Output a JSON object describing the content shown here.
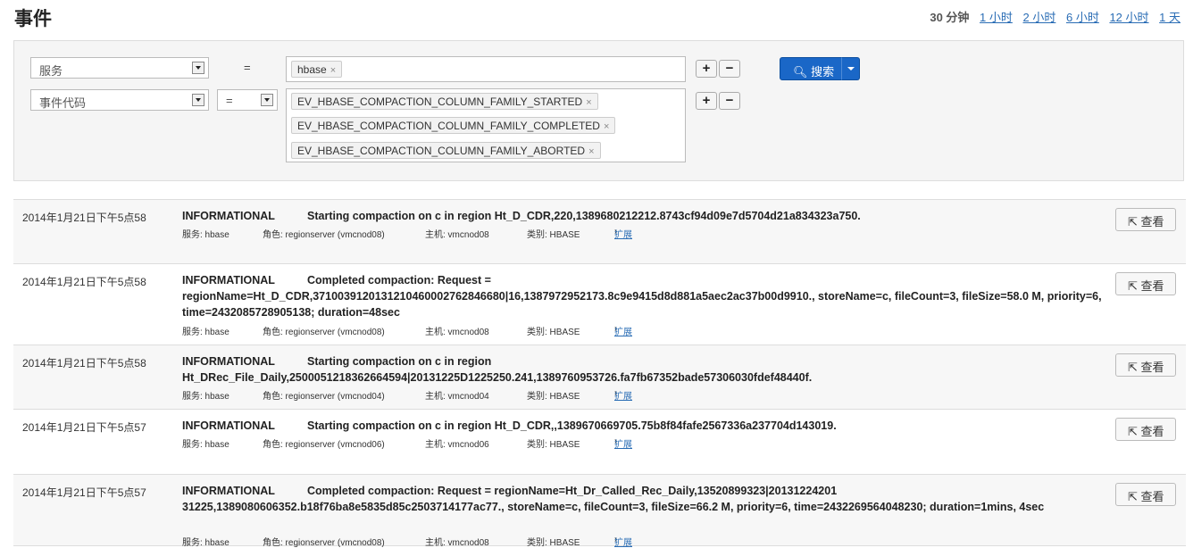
{
  "page": {
    "title": "事件"
  },
  "time_range": {
    "options": [
      "30 分钟",
      "1 小时",
      "2 小时",
      "6 小时",
      "12 小时",
      "1 天"
    ],
    "active": "30 分钟"
  },
  "filters": {
    "row1": {
      "field": "服务",
      "operator": "=",
      "tags": [
        "hbase"
      ]
    },
    "row2": {
      "field": "事件代码",
      "operator": "=",
      "tags": [
        "EV_HBASE_COMPACTION_COLUMN_FAMILY_STARTED",
        "EV_HBASE_COMPACTION_COLUMN_FAMILY_COMPLETED",
        "EV_HBASE_COMPACTION_COLUMN_FAMILY_ABORTED"
      ]
    },
    "add_label": "+",
    "remove_label": "−",
    "search_label": "搜索"
  },
  "events": [
    {
      "date": "2014年1月21日下午5点58",
      "severity": "INFORMATIONAL",
      "message": "Starting compaction on c in region Ht_D_CDR,220,1389680212212.8743cf94d09e7d5704d21a834323a750.",
      "service": "服务: hbase",
      "role": "角色: regionserver (vmcnod08)",
      "host": "主机: vmcnod08",
      "category": "类别: HBASE",
      "expand": "扩展",
      "view": "查看"
    },
    {
      "date": "2014年1月21日下午5点58",
      "severity": "INFORMATIONAL",
      "message": "Completed compaction: Request = regionName=Ht_D_CDR,3710039120131210460002762846680|16,1387972952173.8c9e9415d8d881a5aec2ac37b00d9910., storeName=c, fileCount=3, fileSize=58.0 M, priority=6, time=2432085728905138; duration=48sec",
      "service": "服务: hbase",
      "role": "角色: regionserver (vmcnod08)",
      "host": "主机: vmcnod08",
      "category": "类别: HBASE",
      "expand": "扩展",
      "view": "查看"
    },
    {
      "date": "2014年1月21日下午5点58",
      "severity": "INFORMATIONAL",
      "message": "Starting compaction on c in region Ht_DRec_File_Daily,2500051218362664594|20131225D1225250.241,1389760953726.fa7fb67352bade57306030fdef48440f.",
      "service": "服务: hbase",
      "role": "角色: regionserver (vmcnod04)",
      "host": "主机: vmcnod04",
      "category": "类别: HBASE",
      "expand": "扩展",
      "view": "查看"
    },
    {
      "date": "2014年1月21日下午5点57",
      "severity": "INFORMATIONAL",
      "message": "Starting compaction on c in region Ht_D_CDR,,1389670669705.75b8f84fafe2567336a237704d143019.",
      "service": "服务: hbase",
      "role": "角色: regionserver (vmcnod06)",
      "host": "主机: vmcnod06",
      "category": "类别: HBASE",
      "expand": "扩展",
      "view": "查看"
    },
    {
      "date": "2014年1月21日下午5点57",
      "severity": "INFORMATIONAL",
      "message": "Completed compaction: Request = regionName=Ht_Dr_Called_Rec_Daily,13520899323|20131224201 31225,1389080606352.b18f76ba8e5835d85c2503714177ac77., storeName=c, fileCount=3, fileSize=66.2 M, priority=6, time=2432269564048230; duration=1mins, 4sec",
      "service": "服务: hbase",
      "role": "角色: regionserver (vmcnod08)",
      "host": "主机: vmcnod08",
      "category": "类别: HBASE",
      "expand": "扩展",
      "view": "查看"
    }
  ]
}
